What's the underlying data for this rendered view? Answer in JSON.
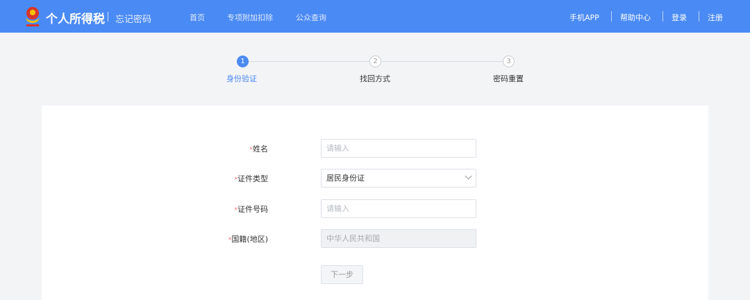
{
  "header": {
    "brand": "个人所得税",
    "subtitle": "忘记密码",
    "nav": [
      "首页",
      "专项附加扣除",
      "公众查询"
    ],
    "right_nav": [
      "手机APP",
      "帮助中心",
      "登录",
      "注册"
    ]
  },
  "steps": [
    {
      "num": "1",
      "label": "身份验证"
    },
    {
      "num": "2",
      "label": "找回方式"
    },
    {
      "num": "3",
      "label": "密码重置"
    }
  ],
  "form": {
    "required_mark": "*",
    "name": {
      "label": "姓名",
      "placeholder": "请输入"
    },
    "id_type": {
      "label": "证件类型",
      "value": "居民身份证"
    },
    "id_number": {
      "label": "证件号码",
      "placeholder": "请输入"
    },
    "nationality": {
      "label": "国籍(地区)",
      "value": "中华人民共和国"
    },
    "next_label": "下一步"
  },
  "colors": {
    "primary": "#4a8af4",
    "required": "#f56c6c"
  }
}
